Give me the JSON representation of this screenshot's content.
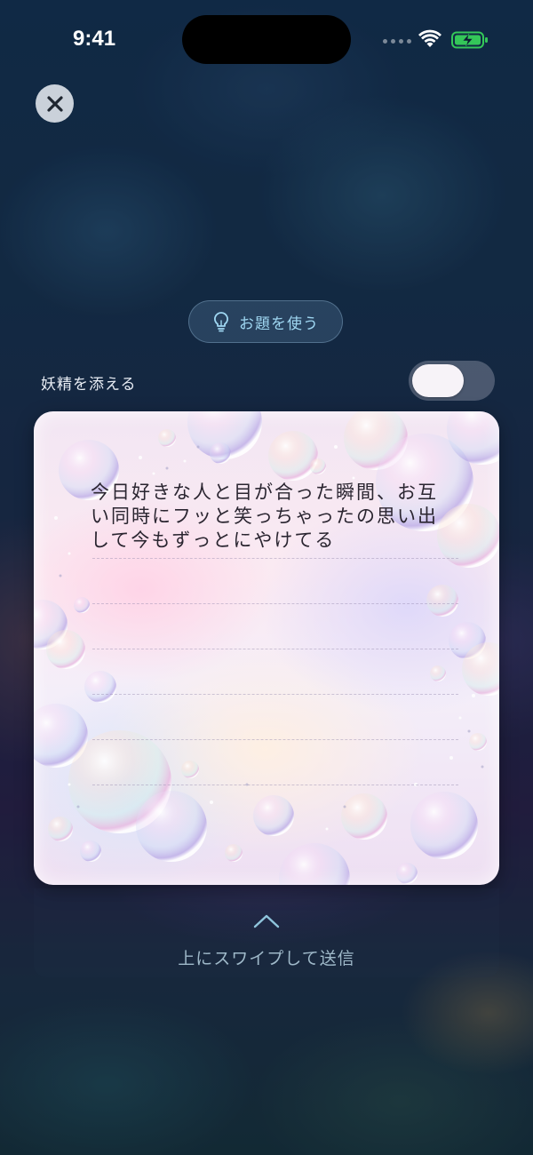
{
  "status_bar": {
    "time": "9:41"
  },
  "close_button": {
    "icon": "close-icon"
  },
  "prompt_button": {
    "label": "お題を使う",
    "icon": "lightbulb-icon"
  },
  "fairy_toggle": {
    "label": "妖精を添える",
    "state": "off"
  },
  "letter": {
    "text": "今日好きな人と目が合った瞬間、お互い同時にフッと笑っちゃったの思い出して今もずっとにやけてる"
  },
  "swipe_hint": {
    "label": "上にスワイプして送信",
    "icon": "chevron-up-icon"
  },
  "colors": {
    "accent": "#9fd7f2",
    "battery": "#34c759"
  }
}
